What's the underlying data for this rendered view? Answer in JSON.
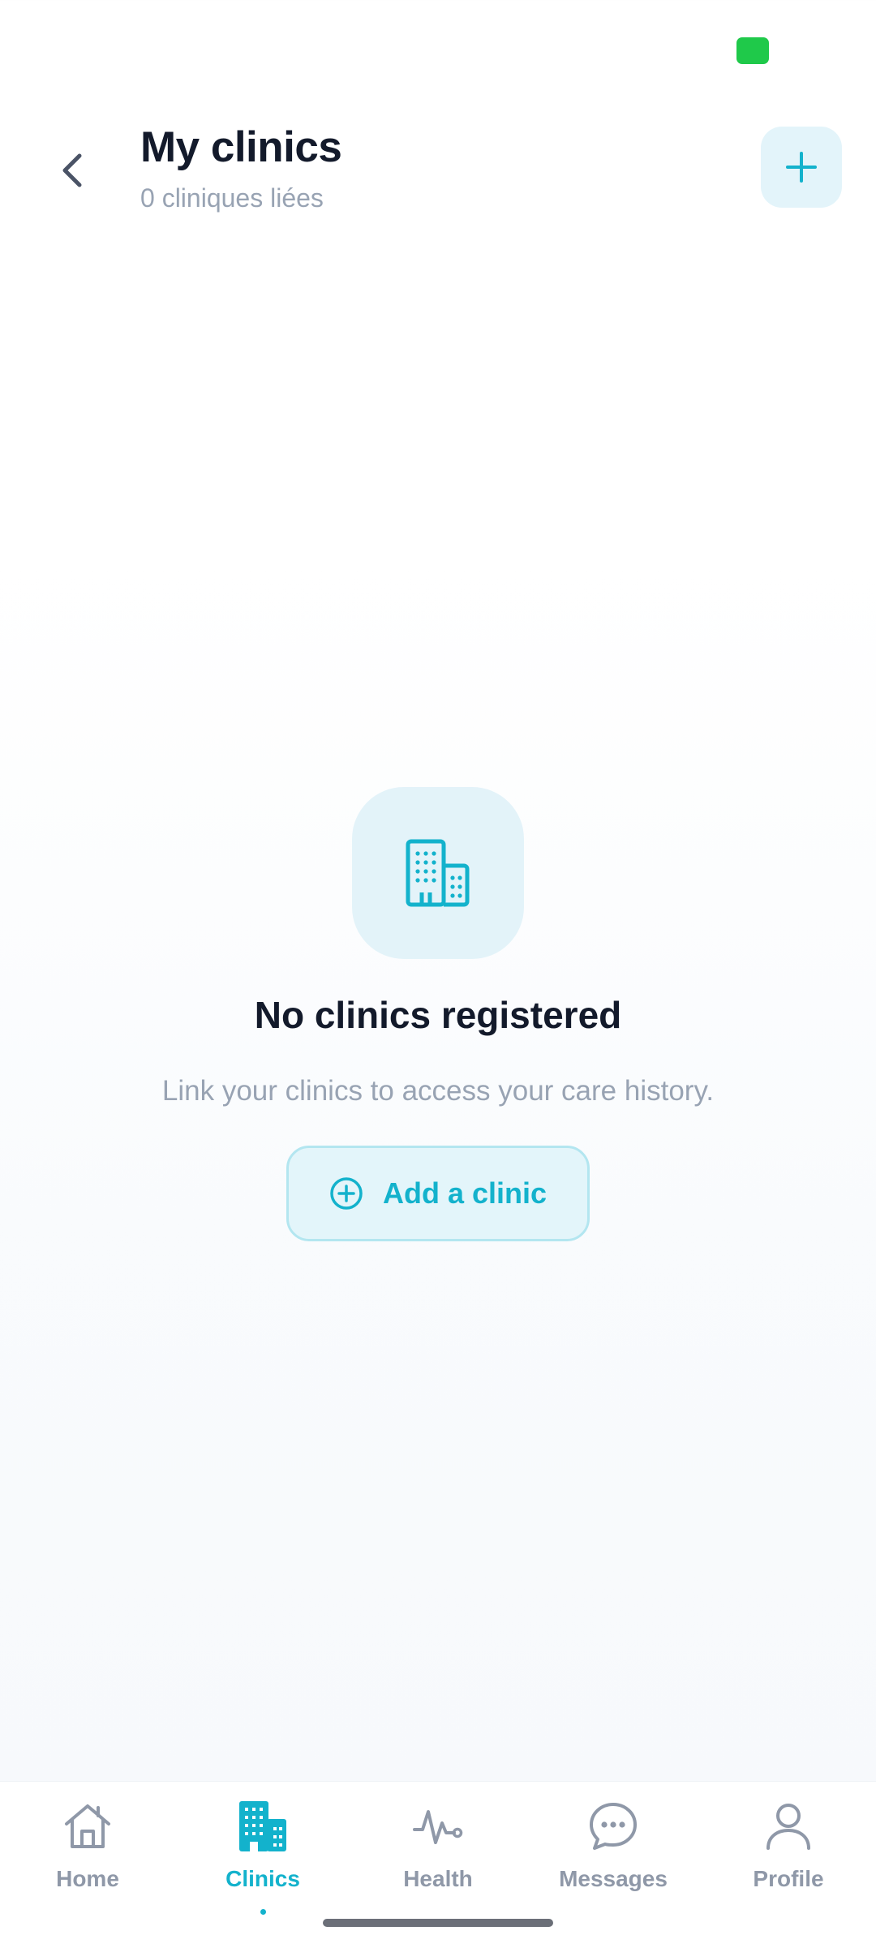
{
  "header": {
    "title": "My clinics",
    "subtitle": "0 cliniques liées",
    "back_icon": "chevron-left-icon",
    "add_icon": "plus-icon"
  },
  "empty_state": {
    "icon": "building-icon",
    "title": "No clinics registered",
    "description": "Link your clinics to access your care history.",
    "button_label": "Add a clinic",
    "button_icon": "plus-circle-icon"
  },
  "bottom_nav": {
    "items": [
      {
        "label": "Home",
        "icon": "home-icon"
      },
      {
        "label": "Clinics",
        "icon": "building-icon",
        "active": true
      },
      {
        "label": "Health",
        "icon": "pulse-icon"
      },
      {
        "label": "Messages",
        "icon": "chat-bubble-icon"
      },
      {
        "label": "Profile",
        "icon": "user-icon"
      }
    ]
  },
  "colors": {
    "accent": "#13b2cc",
    "accent_bg": "#e3f4fa",
    "text_primary": "#131a2b",
    "text_muted": "#98a3b3",
    "status_green": "#1fc94a"
  }
}
